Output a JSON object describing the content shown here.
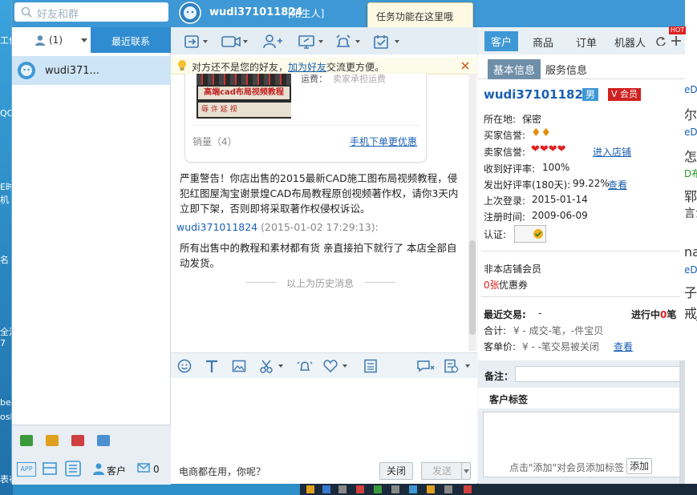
{
  "search": {
    "placeholder": "好友和群"
  },
  "title": {
    "user": "wudi371011824",
    "tag": "[陌生人]"
  },
  "tooltip": "任务功能在这里哦",
  "left_tabs": {
    "contacts_count": "(1)",
    "recent": "最近联系"
  },
  "contact": {
    "name": "wudi371..."
  },
  "right_tabs": [
    "客户",
    "商品",
    "订单",
    "机器人"
  ],
  "hot_badge": "HOT",
  "notice": {
    "prefix": "对方还不是您的好友，",
    "link": "加为好友",
    "suffix": "交流更方便。"
  },
  "card": {
    "shipping": "运费：",
    "shipping_val": "卖家承担运费",
    "img_title": "高端cad布局视频教程",
    "img_sub": "辱 许 延 视",
    "sales": "销量（4）",
    "mobile_link": "手机下单更优惠"
  },
  "messages": [
    {
      "text": "严重警告！你店出售的2015最新CAD施工图布局视频教程，侵犯红图屋淘宝谢景煌CAD布局教程原创视频著作权，请你3天内立即下架，否则即将采取著作权侵权诉讼。"
    },
    {
      "sender": "wudi371011824",
      "time": "(2015-01-02 17:29:13):",
      "text": "所有出售中的教程和素材都有货  亲直接拍下就行了 本店全部自动发货。"
    }
  ],
  "history_label": "以上为历史消息",
  "send_bar": {
    "hint": "电商都在用，你呢？",
    "close": "关闭",
    "send": "发送"
  },
  "info_tabs": [
    "基本信息",
    "服务信息"
  ],
  "profile": {
    "name": "wudi371011824",
    "gender": "男",
    "vip": "会员",
    "location_label": "所在地:",
    "location": "保密",
    "buyer_label": "买家信誉:",
    "seller_label": "卖家信誉:",
    "shop_link": "进入店铺",
    "good_recv_label": "收到好评率:",
    "good_recv": "100%",
    "good_sent_label": "发出好评率(180天):",
    "good_sent": "99.22%",
    "view": "查看",
    "last_login_label": "上次登录:",
    "last_login": "2015-01-14",
    "reg_label": "注册时间:",
    "reg": "2009-06-09",
    "auth_label": "认证:"
  },
  "member": {
    "non_member": "非本店铺会员",
    "coupon_count": "0张",
    "coupon_text": "优惠券"
  },
  "trade": {
    "recent_label": "最近交易:",
    "recent": "-",
    "in_progress_label": "进行中",
    "in_progress_count": "0",
    "in_progress_unit": "笔",
    "total_label": "合计:",
    "total": "¥ -   成交-笔，-件宝贝",
    "avg_label": "客单价:",
    "avg": "¥ -   -笔交易被关闭",
    "view": "查看"
  },
  "notes_label": "备注：",
  "tags": {
    "label": "客户标签",
    "hint": "点击\"添加\"对会员添加标签",
    "add": "添加"
  },
  "bottom_icons": {
    "customer": "客户",
    "mail_count": "0"
  },
  "desktop": {
    "left": [
      "工作",
      "QQ",
      "E时",
      "机",
      "名",
      "全消",
      "7",
      "be",
      "osh",
      "表布"
    ],
    "right": [
      "eD",
      "尔x",
      "eD",
      "怎",
      "D布",
      "郓",
      "言か",
      "na",
      "eD",
      "子I",
      "戒J"
    ]
  },
  "colors": {
    "titlebar": "#3e98d5",
    "accent": "#1a5fb4",
    "red": "#e02020"
  }
}
